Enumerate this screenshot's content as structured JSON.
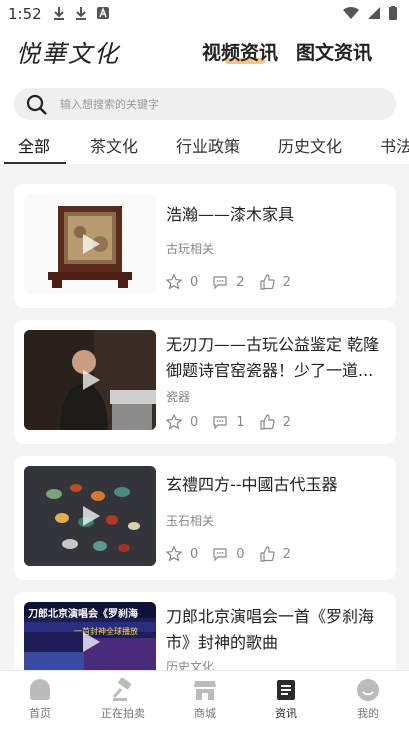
{
  "status_bar": {
    "time": "1:52"
  },
  "header": {
    "logo_text": "悦華文化",
    "tabs": [
      {
        "label": "视频资讯",
        "active": true
      },
      {
        "label": "图文资讯",
        "active": false
      }
    ]
  },
  "search": {
    "placeholder": "输入想搜索的关键字"
  },
  "categories": [
    {
      "label": "全部",
      "active": true
    },
    {
      "label": "茶文化"
    },
    {
      "label": "行业政策"
    },
    {
      "label": "历史文化"
    },
    {
      "label": "书法"
    }
  ],
  "articles": [
    {
      "title": "浩瀚——漆木家具",
      "category": "古玩相关",
      "favorites": "0",
      "comments": "2",
      "likes": "2"
    },
    {
      "title": "无刃刀——古玩公益鉴定 乾隆御题诗官窑瓷器！少了一道...",
      "category": "瓷器",
      "favorites": "0",
      "comments": "1",
      "likes": "2"
    },
    {
      "title": "玄禮四方--中國古代玉器",
      "category": "玉石相关",
      "favorites": "0",
      "comments": "0",
      "likes": "2"
    },
    {
      "title": "刀郎北京演唱会一首《罗刹海市》封神的歌曲",
      "category": "历史文化",
      "favorites": "",
      "comments": "",
      "likes": "",
      "thumb_text_1": "刀郎北京演唱会《罗刹海",
      "thumb_text_2": "一首封神全球播放"
    }
  ],
  "bottom_nav": [
    {
      "label": "首页",
      "icon": "home-icon"
    },
    {
      "label": "正在拍卖",
      "icon": "auction-hammer-icon"
    },
    {
      "label": "商城",
      "icon": "shop-icon"
    },
    {
      "label": "资讯",
      "icon": "news-icon",
      "active": true
    },
    {
      "label": "我的",
      "icon": "profile-icon"
    }
  ],
  "colors": {
    "accent_underline": "#f2c58a",
    "background": "#f4f4f4",
    "card": "#ffffff"
  }
}
